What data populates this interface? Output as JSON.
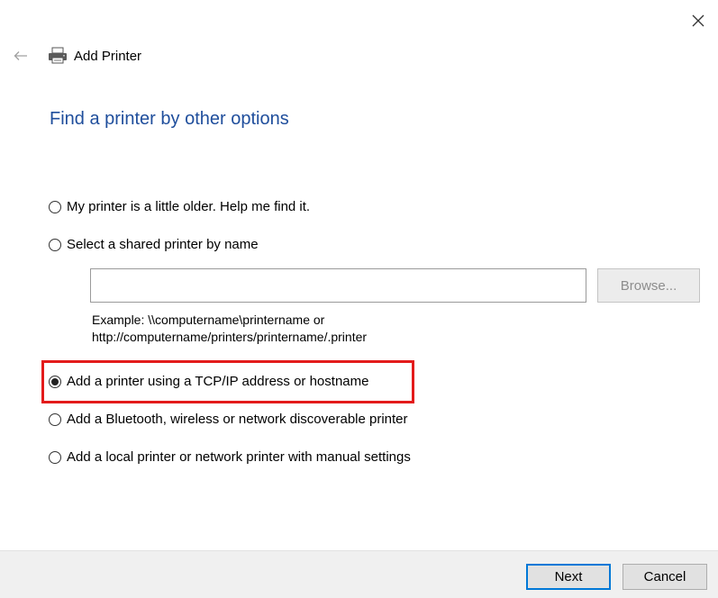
{
  "window": {
    "title": "Add Printer",
    "close_icon": "close-icon",
    "back_icon": "back-arrow-icon",
    "printer_icon": "printer-icon"
  },
  "page": {
    "heading": "Find a printer by other options"
  },
  "options": [
    {
      "label": "My printer is a little older. Help me find it.",
      "selected": false
    },
    {
      "label": "Select a shared printer by name",
      "selected": false
    },
    {
      "label": "Add a printer using a TCP/IP address or hostname",
      "selected": true
    },
    {
      "label": "Add a Bluetooth, wireless or network discoverable printer",
      "selected": false
    },
    {
      "label": "Add a local printer or network printer with manual settings",
      "selected": false
    }
  ],
  "share": {
    "value": "",
    "browse_label": "Browse...",
    "example_line1": "Example: \\\\computername\\printername or",
    "example_line2": "http://computername/printers/printername/.printer"
  },
  "footer": {
    "next_label": "Next",
    "cancel_label": "Cancel"
  },
  "colors": {
    "heading": "#1f4e9c",
    "highlight": "#e31b1b",
    "footer_bg": "#f0f0f0",
    "next_border": "#0078d7"
  }
}
